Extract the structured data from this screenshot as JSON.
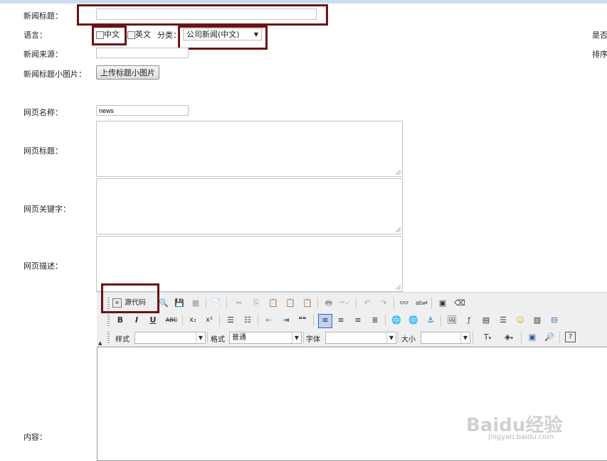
{
  "form": {
    "news_title_label": "新闻标题：",
    "news_title_value": "",
    "language_label": "语言：",
    "lang_zh": "中文",
    "lang_en": "英文",
    "category_label": "分类：",
    "category_value": "公司新闻(中文)",
    "source_label": "新闻来源：",
    "source_value": "",
    "thumb_label": "新闻标题小图片：",
    "upload_button": "上传标题小图片",
    "right_publish_label": "是否",
    "right_sort_label": "排序",
    "page_name_label": "网页名称：",
    "page_name_value": "news",
    "page_title_label": "网页标题：",
    "page_keywords_label": "网页关键字：",
    "page_desc_label": "网页描述：",
    "content_label": "内容："
  },
  "editor": {
    "source_button": "源代码",
    "style_label": "样式",
    "style_value": "",
    "format_label": "格式",
    "format_value": "普通",
    "font_label": "字体",
    "font_value": "",
    "size_label": "大小",
    "size_value": "",
    "row1_icons": [
      "preview-icon",
      "save-icon",
      "templates-icon",
      "new-page-icon",
      "cut-icon",
      "copy-icon",
      "paste-icon",
      "paste-text-icon",
      "paste-word-icon",
      "print-icon",
      "spellcheck-icon",
      "undo-icon",
      "redo-icon",
      "find-icon",
      "replace-icon",
      "select-all-icon",
      "remove-format-icon"
    ],
    "row2_icons": [
      "bold-icon",
      "italic-icon",
      "underline-icon",
      "strike-icon",
      "subscript-icon",
      "superscript-icon",
      "ordered-list-icon",
      "unordered-list-icon",
      "outdent-icon",
      "indent-icon",
      "blockquote-icon",
      "align-left-icon",
      "align-center-icon",
      "align-right-icon",
      "justify-icon",
      "link-icon",
      "unlink-icon",
      "anchor-icon",
      "image-icon",
      "flash-icon",
      "table-icon",
      "hr-icon",
      "smiley-icon",
      "special-char-icon",
      "page-break-icon"
    ],
    "glyphs": {
      "bold": "B",
      "italic": "I",
      "underline": "U",
      "strike": "ABC",
      "sub": "x₂",
      "sup": "x²",
      "quote": "❝❝"
    }
  },
  "watermark": {
    "brand": "Baidu经验",
    "url": "jingyan.baidu.com"
  },
  "colors": {
    "highlight_border": "#6b1416",
    "toolbar_bg": "#efefef",
    "top_bar": "#c9dff0"
  }
}
